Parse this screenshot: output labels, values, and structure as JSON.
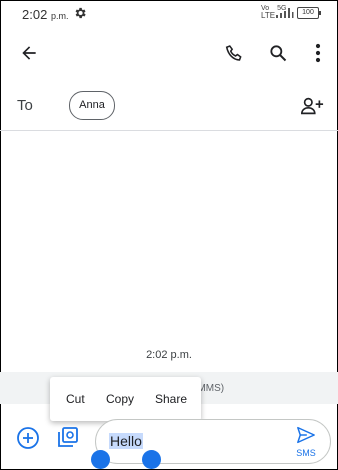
{
  "status_bar": {
    "time": "2:02",
    "time_suffix": "p.m.",
    "network_top": "Vo",
    "network_mid": "LTE",
    "network_g": "5G",
    "battery": "100"
  },
  "header": {
    "back_icon": "arrow-back-icon",
    "call_icon": "phone-icon",
    "search_icon": "search-icon",
    "more_icon": "more-vert-icon"
  },
  "recipients": {
    "to_label": "To",
    "chips": [
      "Anna"
    ],
    "add_icon": "add-person-icon"
  },
  "conversation": {
    "timestamp": "2:02 p.m.",
    "hint_visible": "S/MMS)"
  },
  "context_menu": {
    "items": [
      "Cut",
      "Copy",
      "Share"
    ]
  },
  "compose": {
    "text": "Hello",
    "send_label": "SMS",
    "attach_icon": "add-circle-icon",
    "gallery_icon": "gallery-icon"
  },
  "colors": {
    "accent": "#1a73e8",
    "selection": "#c6dafc",
    "hint_bg": "#f1f3f4"
  }
}
